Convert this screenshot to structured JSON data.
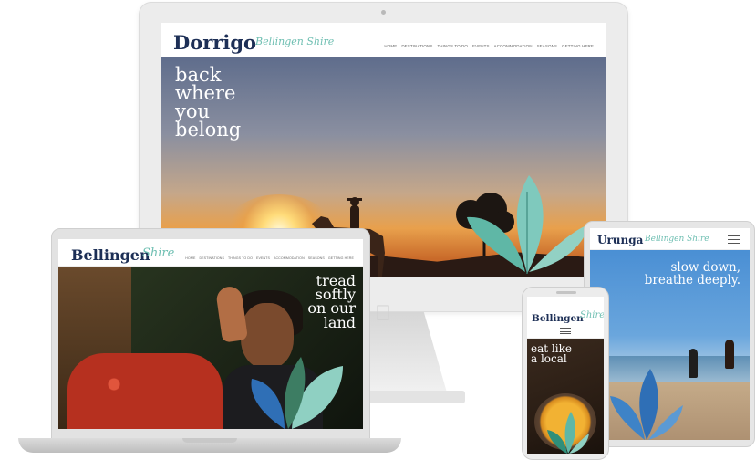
{
  "imac": {
    "brand_main": "Dorrigo",
    "brand_script": "Bellingen Shire",
    "nav": [
      "HOME",
      "DESTINATIONS",
      "THINGS TO DO",
      "EVENTS",
      "ACCOMMODATION",
      "SEASONS",
      "GETTING HERE"
    ],
    "hero_lines": [
      "back",
      "where",
      "you",
      "belong"
    ],
    "apple_icon": "apple-logo-icon"
  },
  "laptop": {
    "brand_main": "Bellingen",
    "brand_script": "Shire",
    "nav": [
      "HOME",
      "DESTINATIONS",
      "THINGS TO DO",
      "EVENTS",
      "ACCOMMODATION",
      "SEASONS",
      "GETTING HERE"
    ],
    "hero_lines": [
      "tread",
      "softly",
      "on our",
      "land"
    ]
  },
  "tablet": {
    "brand_main": "Urunga",
    "brand_script": "Bellingen Shire",
    "hero_lines": [
      "slow down,",
      "breathe deeply."
    ],
    "menu_icon": "hamburger-menu-icon"
  },
  "phone": {
    "brand_main": "Bellingen",
    "brand_script": "Shire",
    "hero_lines": [
      "eat like",
      "a local"
    ],
    "menu_icon": "hamburger-menu-icon"
  },
  "colors": {
    "navy": "#1d2f56",
    "teal_script": "#6fbfb2",
    "leaf_teal": "#5fb7a6",
    "leaf_blue": "#2f6fb6"
  }
}
